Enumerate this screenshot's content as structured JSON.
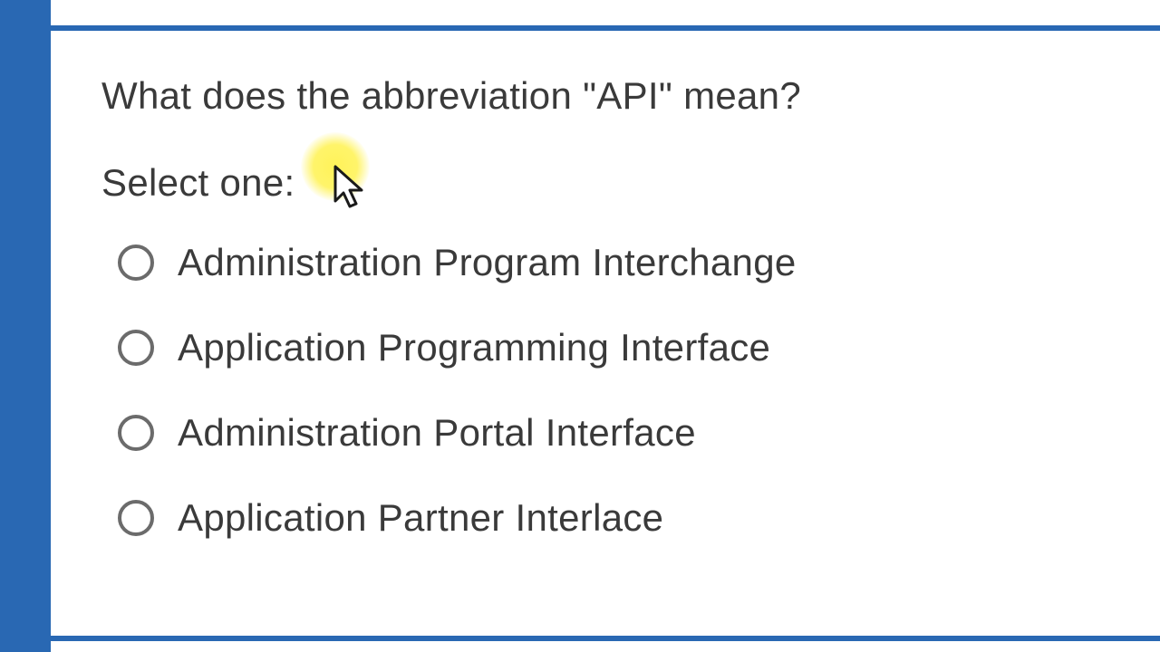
{
  "question": {
    "text": "What does the abbreviation \"API\" mean?",
    "prompt": "Select one:",
    "options": [
      {
        "label": "Administration Program Interchange"
      },
      {
        "label": "Application Programming Interface"
      },
      {
        "label": "Administration Portal Interface"
      },
      {
        "label": "Application Partner Interlace"
      }
    ]
  },
  "colors": {
    "accent": "#2968b3",
    "highlight": "#fff250"
  }
}
